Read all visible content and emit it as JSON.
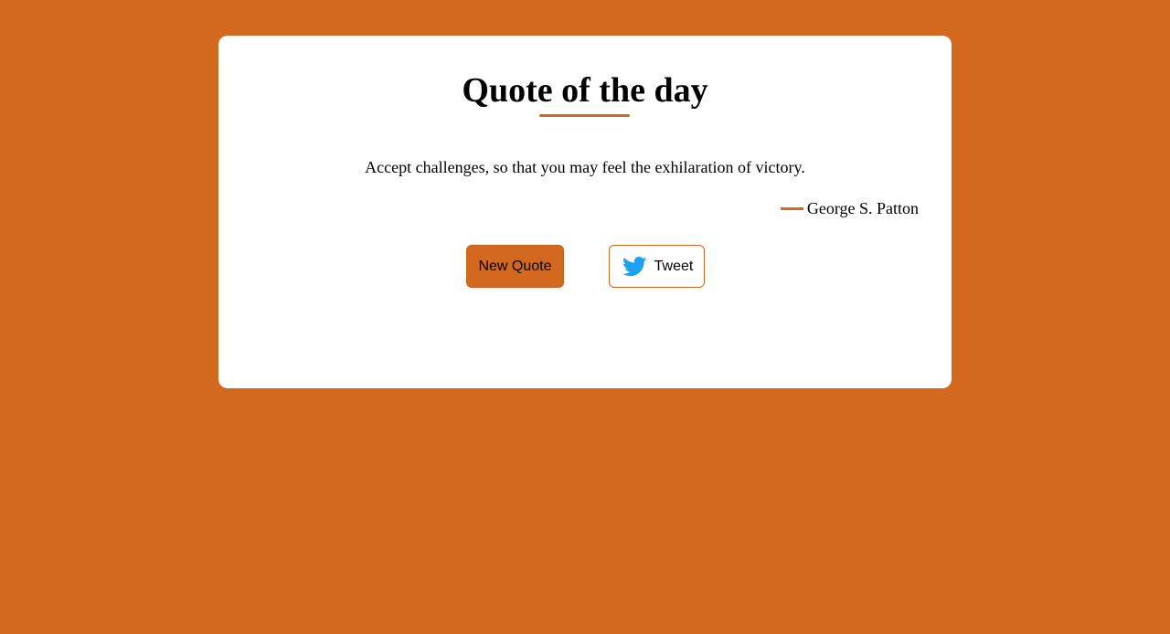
{
  "card": {
    "title": "Quote of the day",
    "quote": "Accept challenges, so that you may feel the exhilaration of victory.",
    "author": "George S. Patton"
  },
  "buttons": {
    "new_quote_label": "New Quote",
    "tweet_label": "Tweet"
  },
  "icons": {
    "tweet_icon": "twitter-bird-icon",
    "author_marker": "dash"
  },
  "colors": {
    "background": "#d2691e",
    "card": "#ffffff",
    "accent": "#d2691e",
    "twitter_blue": "#1da1f2"
  }
}
